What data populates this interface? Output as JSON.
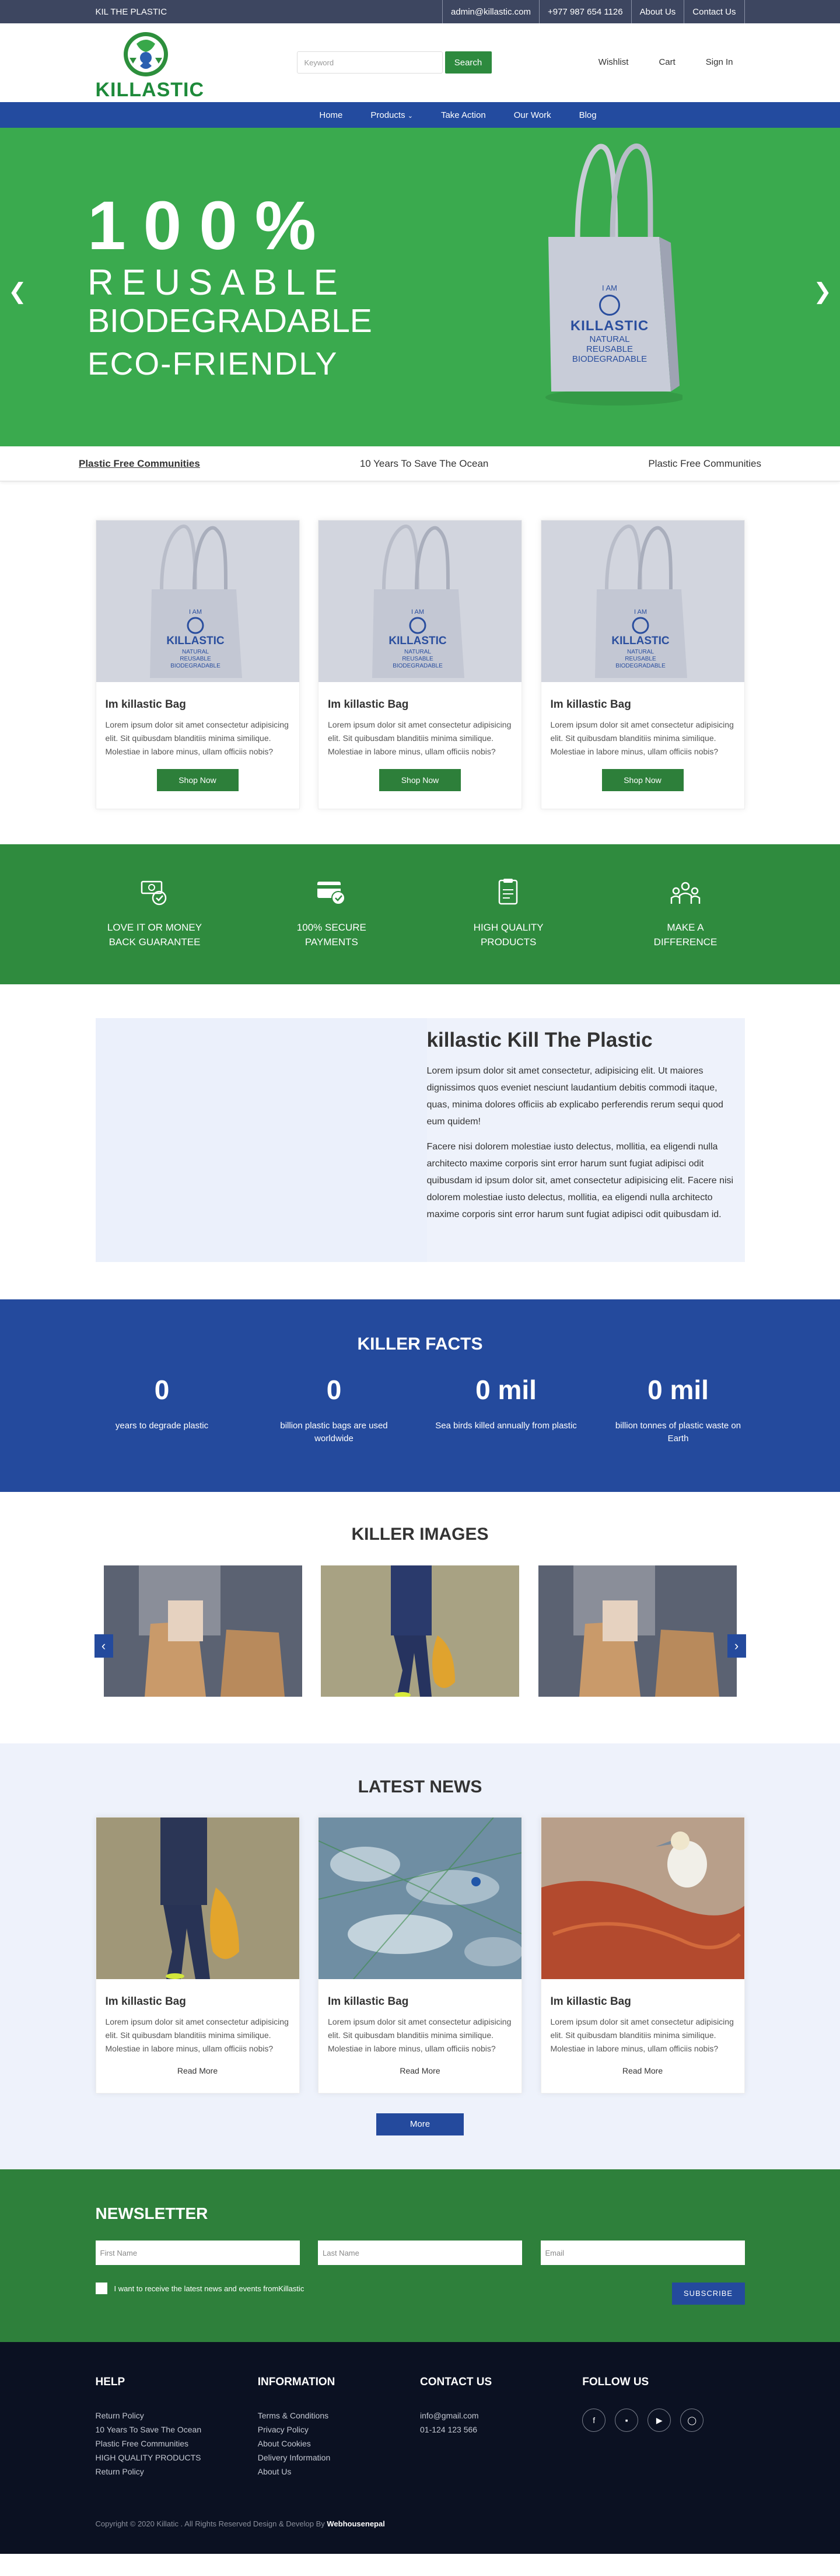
{
  "topbar": {
    "brand": "KIL THE PLASTIC",
    "email": "admin@killastic.com",
    "phone": "+977 987 654 1126",
    "about": "About Us",
    "contact": "Contact Us"
  },
  "header": {
    "logo_text": "KILLASTIC",
    "search_placeholder": "Keyword",
    "search_btn": "Search",
    "wishlist": "Wishlist",
    "cart": "Cart",
    "signin": "Sign In"
  },
  "nav": {
    "home": "Home",
    "products": "Products",
    "take_action": "Take Action",
    "our_work": "Our Work",
    "blog": "Blog"
  },
  "hero": {
    "line1": "100%",
    "line2": "REUSABLE",
    "line3": "BIODEGRADABLE",
    "line4": "ECO-FRIENDLY",
    "bag": {
      "line1": "I AM",
      "line2": "KILLASTIC",
      "line3": "NATURAL",
      "line4": "REUSABLE",
      "line5": "BIODEGRADABLE"
    }
  },
  "tabs": [
    "Plastic Free Communities",
    "10 Years To Save The Ocean",
    "Plastic Free Communities"
  ],
  "products": [
    {
      "title": "Im killastic Bag",
      "text": "Lorem ipsum dolor sit amet consectetur adipisicing elit. Sit quibusdam blanditiis minima similique. Molestiae in labore minus, ullam officiis nobis?",
      "btn": "Shop Now"
    },
    {
      "title": "Im killastic Bag",
      "text": "Lorem ipsum dolor sit amet consectetur adipisicing elit. Sit quibusdam blanditiis minima similique. Molestiae in labore minus, ullam officiis nobis?",
      "btn": "Shop Now"
    },
    {
      "title": "Im killastic Bag",
      "text": "Lorem ipsum dolor sit amet consectetur adipisicing elit. Sit quibusdam blanditiis minima similique. Molestiae in labore minus, ullam officiis nobis?",
      "btn": "Shop Now"
    }
  ],
  "features": [
    {
      "l1": "LOVE IT OR MONEY",
      "l2": "BACK GUARANTEE",
      "icon": "money-back-icon"
    },
    {
      "l1": "100% SECURE",
      "l2": "PAYMENTS",
      "icon": "secure-payment-icon"
    },
    {
      "l1": "HIGH QUALITY",
      "l2": "PRODUCTS",
      "icon": "quality-icon"
    },
    {
      "l1": "MAKE A",
      "l2": "DIFFERENCE",
      "icon": "community-icon"
    }
  ],
  "about": {
    "title": "killastic Kill The Plastic",
    "p1": "Lorem ipsum dolor sit amet consectetur, adipisicing elit. Ut maiores dignissimos quos eveniet nesciunt laudantium debitis commodi itaque, quas, minima dolores officiis ab explicabo perferendis rerum sequi quod eum quidem!",
    "p2": "Facere nisi dolorem molestiae iusto delectus, mollitia, ea eligendi nulla architecto maxime corporis sint error harum sunt fugiat adipisci odit quibusdam id ipsum dolor sit, amet consectetur adipisicing elit. Facere nisi dolorem molestiae iusto delectus, mollitia, ea eligendi nulla architecto maxime corporis sint error harum sunt fugiat adipisci odit quibusdam id."
  },
  "facts": {
    "title": "KILLER FACTS",
    "items": [
      {
        "n": "0",
        "l": "years to degrade plastic"
      },
      {
        "n": "0",
        "l": "billion plastic bags are used worldwide"
      },
      {
        "n": "0 mil",
        "l": "Sea birds killed annually from plastic"
      },
      {
        "n": "0 mil",
        "l": "billion tonnes of plastic waste on Earth"
      }
    ]
  },
  "images": {
    "title": "KILLER IMAGES"
  },
  "news": {
    "title": "LATEST NEWS",
    "more": "More",
    "items": [
      {
        "title": "Im killastic Bag",
        "text": "Lorem ipsum dolor sit amet consectetur adipisicing elit. Sit quibusdam blanditiis minima similique. Molestiae in labore minus, ullam officiis nobis?",
        "link": "Read More"
      },
      {
        "title": "Im killastic Bag",
        "text": "Lorem ipsum dolor sit amet consectetur adipisicing elit. Sit quibusdam blanditiis minima similique. Molestiae in labore minus, ullam officiis nobis?",
        "link": "Read More"
      },
      {
        "title": "Im killastic Bag",
        "text": "Lorem ipsum dolor sit amet consectetur adipisicing elit. Sit quibusdam blanditiis minima similique. Molestiae in labore minus, ullam officiis nobis?",
        "link": "Read More"
      }
    ]
  },
  "newsletter": {
    "title": "NEWSLETTER",
    "first": "First Name",
    "last": "Last Name",
    "email": "Email",
    "opt": "I want to receive the latest news and events fromKillastic",
    "btn": "SUBSCRIBE"
  },
  "footer": {
    "help": {
      "title": "HELP",
      "items": [
        "Return Policy",
        "10 Years To Save The Ocean",
        "Plastic Free Communities",
        "HIGH QUALITY PRODUCTS",
        "Return Policy"
      ]
    },
    "info": {
      "title": "INFORMATION",
      "items": [
        "Terms & Conditions",
        "Privacy Policy",
        "About Cookies",
        "Delivery Information",
        "About Us"
      ]
    },
    "contact": {
      "title": "CONTACT US",
      "email": "info@gmail.com",
      "phone": "01-124 123 566"
    },
    "follow": {
      "title": "FOLLOW US"
    },
    "copy": "Copyright © 2020 Killatic . All Rights Reserved Design & Develop By",
    "dev": "Webhousenepal"
  },
  "colors": {
    "green": "#3aaa4e",
    "dark_green": "#2f8b3e",
    "blue": "#244a9d",
    "dark": "#0b1122"
  }
}
